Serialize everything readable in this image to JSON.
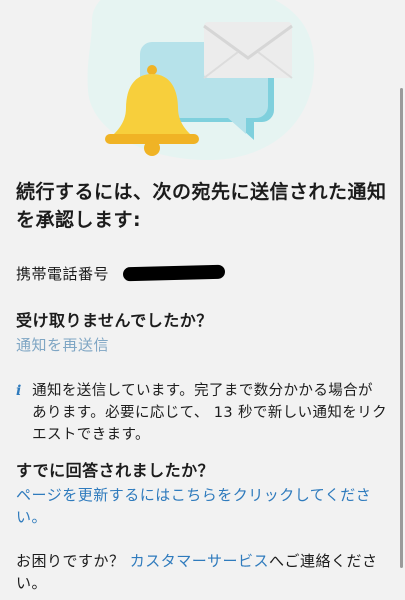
{
  "colors": {
    "background": "#f2f2f2",
    "link": "#2f7bbd",
    "link_muted": "#7fa6c4",
    "bell": "#f7cf3c",
    "bubble": "#b6e2ea",
    "envelope": "#ececec"
  },
  "illustration": {
    "icons": [
      "bell-icon",
      "chat-bubble-icon",
      "envelope-icon"
    ]
  },
  "heading": "続行するには、次の宛先に送信された通知を承認します:",
  "phone": {
    "label": "携帯電話番号"
  },
  "not_received": {
    "question": "受け取りませんでしたか？",
    "resend_link": "通知を再送信"
  },
  "info": {
    "icon": "info-icon",
    "text": "通知を送信しています。完了まで数分かかる場合があります。必要に応じて、 13 秒で新しい通知をリクエストできます。"
  },
  "already_answered": {
    "question": "すでに回答されましたか？",
    "refresh_link": "ページを更新するにはこちらをクリックしてください。"
  },
  "help": {
    "prefix": "お困りですか？ ",
    "link": "カスタマーサービス",
    "suffix": "へご連絡ください。"
  }
}
